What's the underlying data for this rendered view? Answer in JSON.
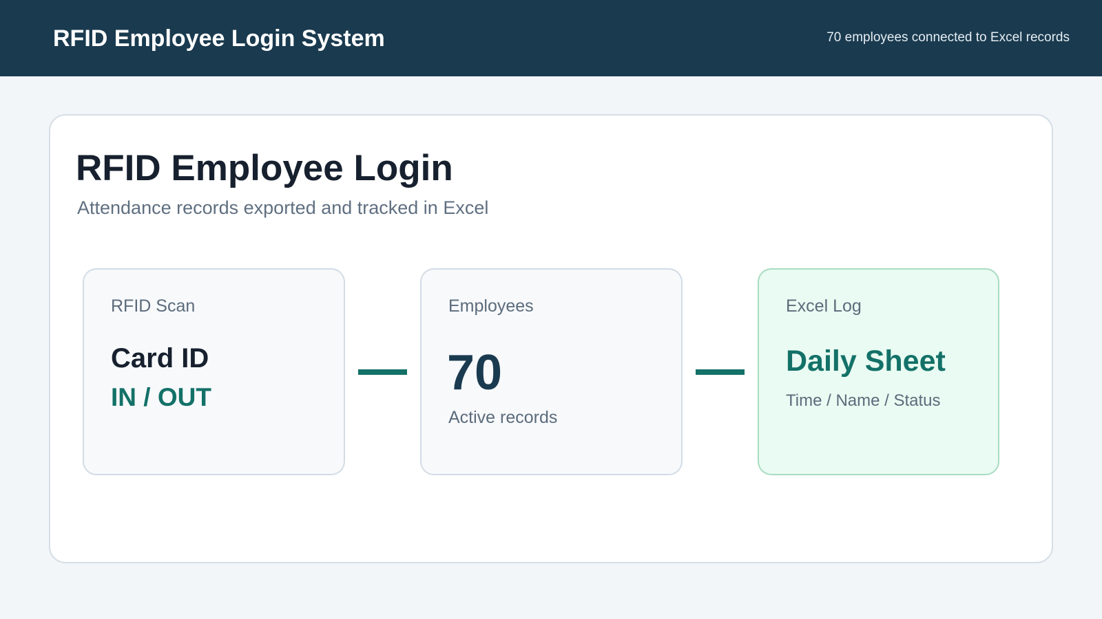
{
  "header": {
    "title": "RFID Employee Login System",
    "status": "70 employees connected to Excel records"
  },
  "main": {
    "title": "RFID Employee Login",
    "subtitle": "Attendance records exported and tracked in Excel"
  },
  "cards": [
    {
      "label": "RFID Scan",
      "primary": "Card ID",
      "accent": "IN / OUT"
    },
    {
      "label": "Employees",
      "value": "70",
      "caption": "Active records"
    },
    {
      "label": "Excel Log",
      "accent": "Daily Sheet",
      "caption": "Time / Name / Status"
    }
  ],
  "colors": {
    "header_bg": "#1a3a4f",
    "accent": "#137168",
    "page_bg": "#f3f6f9",
    "excel_card_bg": "#e9fbf2"
  }
}
